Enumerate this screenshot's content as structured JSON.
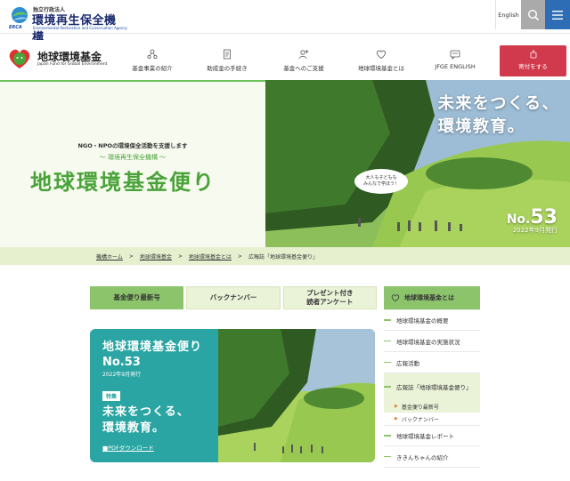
{
  "org": {
    "subtitle": "独立行政法人",
    "name": "環境再生保全機構",
    "en": "Environmental Restoration and Conservation Agency",
    "abbr": "ERCA"
  },
  "topbar": {
    "english": "English",
    "search_icon": "search-icon",
    "menu_icon": "hamburger-menu-icon"
  },
  "fund": {
    "name": "地球環境基金",
    "en": "Japan Fund for Global Environment"
  },
  "nav": [
    {
      "label": "基金事業の紹介",
      "icon": "network-icon"
    },
    {
      "label": "助成金の手続き",
      "icon": "document-icon"
    },
    {
      "label": "基金へのご支援",
      "icon": "person-plus-icon"
    },
    {
      "label": "地球環境基金とは",
      "icon": "heart-icon"
    },
    {
      "label": "JFGE ENGLISH",
      "icon": "chat-icon"
    }
  ],
  "donate": {
    "label": "寄付をする",
    "icon": "piggy-bank-icon"
  },
  "hero": {
    "lead": "NGO・NPOの環境保全活動を支援します",
    "org": "～ 環境再生保全機構 ～",
    "title": "地球環境基金便り",
    "headline_1": "未来をつくる、",
    "headline_2": "環境教育。",
    "bubble_1": "大人も子どもも",
    "bubble_2": "みんなで学ぼう！",
    "issue_prefix": "No.",
    "issue_num": "53",
    "date": "2022年9月発行"
  },
  "breadcrumb": [
    "機構ホーム",
    "地球環境基金",
    "地球環境基金とは",
    "広報誌「地球環境基金便り」"
  ],
  "tabs": [
    {
      "label": "基金便り最新号",
      "active": true
    },
    {
      "label": "バックナンバー",
      "active": false
    },
    {
      "label_1": "プレゼント付き",
      "label_2": "読者アンケート",
      "active": false
    }
  ],
  "card": {
    "title": "地球環境基金便り",
    "issue": "No.53",
    "date": "2022年9月発行",
    "tag": "特集",
    "feature_1": "未来をつくる、",
    "feature_2": "環境教育。",
    "pdf": "■PDFダウンロード"
  },
  "sidebar": {
    "heading": "地球環境基金とは",
    "items": [
      "地球環境基金の概要",
      "地球環境基金の実施状況",
      "広報活動",
      "広報誌「地球環境基金便り」"
    ],
    "subitems": [
      "基金便り最新号",
      "バックナンバー"
    ],
    "items_after": [
      "地球環境基金レポート",
      "ききんちゃんの紹介"
    ]
  },
  "colors": {
    "brand_green": "#4aa33a",
    "accent_green": "#8cc46c",
    "teal": "#2aa5a3",
    "donate_red": "#d03a4c",
    "navy": "#1a2a6e"
  }
}
